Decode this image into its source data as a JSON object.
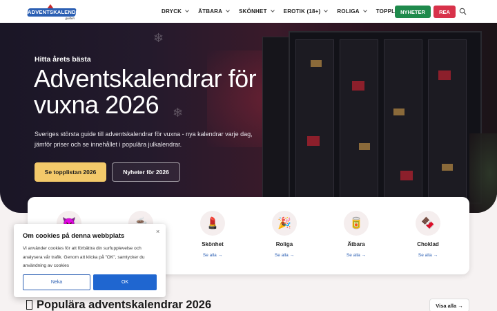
{
  "header": {
    "logo_text": "ADVENTSKALENDER",
    "logo_sub": "guiden",
    "nav": [
      {
        "label": "DRYCK",
        "has_dropdown": true
      },
      {
        "label": "ÄTBARA",
        "has_dropdown": true
      },
      {
        "label": "SKÖNHET",
        "has_dropdown": true
      },
      {
        "label": "EROTIK (18+)",
        "has_dropdown": true
      },
      {
        "label": "ROLIGA",
        "has_dropdown": true
      },
      {
        "label": "TOPPLISTA",
        "has_dropdown": false
      }
    ],
    "news_button": "NYHETER",
    "sale_button": "REA",
    "search_icon": "search-icon"
  },
  "hero": {
    "kicker": "Hitta årets bästa",
    "title": "Adventskalendrar för vuxna 2026",
    "description": "Sveriges största guide till adventskalendrar för vuxna - nya kalendrar varje dag, jämför priser och se innehållet i populära julkalendrar.",
    "primary_button": "Se topplistan 2026",
    "secondary_button": "Nyheter för 2026"
  },
  "categories": [
    {
      "name": "",
      "more": "",
      "icon": "devil-icon",
      "emoji": "😈"
    },
    {
      "name": "",
      "more": "",
      "icon": "coffee-icon",
      "emoji": "☕"
    },
    {
      "name": "Skönhet",
      "more": "Se alla →",
      "icon": "cosmetics-icon",
      "emoji": "💄"
    },
    {
      "name": "Roliga",
      "more": "Se alla →",
      "icon": "party-popper-icon",
      "emoji": "🎉"
    },
    {
      "name": "Ätbara",
      "more": "Se alla →",
      "icon": "jar-icon",
      "emoji": "🥫"
    },
    {
      "name": "Choklad",
      "more": "Se alla →",
      "icon": "chocolate-icon",
      "emoji": "🍫"
    }
  ],
  "cookie": {
    "title": "Om cookies på denna webbplats",
    "text": "Vi använder cookies för att förbättra din surfupplevelse och analysera vår trafik. Genom att klicka på \"OK\", samtycker du användning av cookies",
    "decline": "Neka",
    "accept": "OK",
    "close": "×"
  },
  "popular": {
    "title": "Populära adventskalendrar 2026",
    "view_all": "Visa alla →"
  },
  "colors": {
    "accent_green": "#1f8a4c",
    "accent_red": "#d8324a",
    "cta_yellow": "#f3c96a",
    "link_blue": "#2b5fb3"
  }
}
